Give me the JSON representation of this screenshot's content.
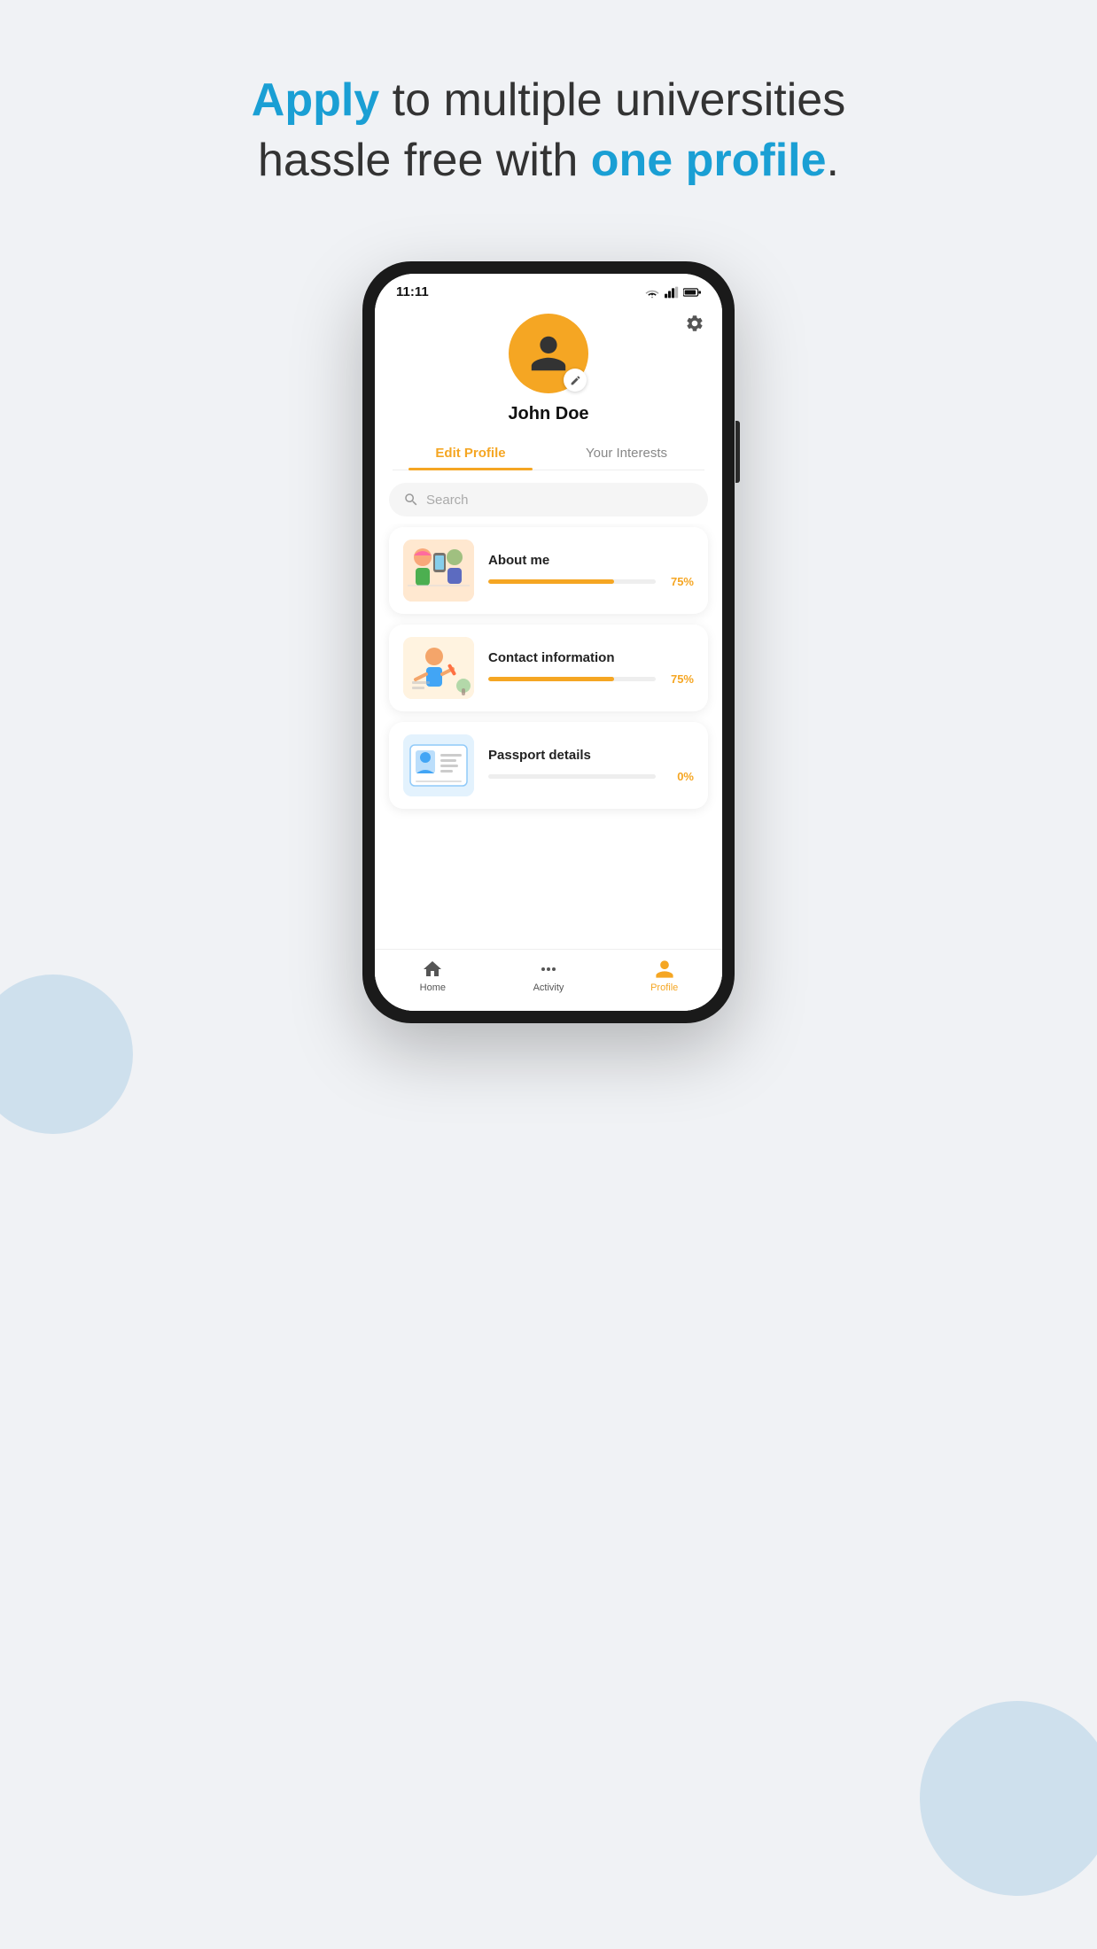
{
  "headline": {
    "part1": "Apply",
    "part2": " to multiple universities",
    "part3": "hassle free with ",
    "part4": "one profile",
    "part5": "."
  },
  "phone": {
    "status_time": "11:11",
    "user_name": "John Doe",
    "tabs": [
      {
        "id": "edit",
        "label": "Edit Profile",
        "active": true
      },
      {
        "id": "interests",
        "label": "Your Interests",
        "active": false
      }
    ],
    "search_placeholder": "Search",
    "cards": [
      {
        "id": "about",
        "title": "About me",
        "progress": 75,
        "progress_label": "75%"
      },
      {
        "id": "contact",
        "title": "Contact information",
        "progress": 75,
        "progress_label": "75%"
      },
      {
        "id": "passport",
        "title": "Passport details",
        "progress": 0,
        "progress_label": "0%"
      }
    ],
    "bottom_nav": [
      {
        "id": "home",
        "label": "Home",
        "active": false,
        "icon": "home"
      },
      {
        "id": "activity",
        "label": "Activity",
        "active": false,
        "icon": "activity"
      },
      {
        "id": "profile",
        "label": "Profile",
        "active": true,
        "icon": "profile"
      }
    ]
  },
  "colors": {
    "accent_orange": "#f5a623",
    "accent_blue": "#1a9fd4",
    "progress_fill": "#f5a623"
  }
}
